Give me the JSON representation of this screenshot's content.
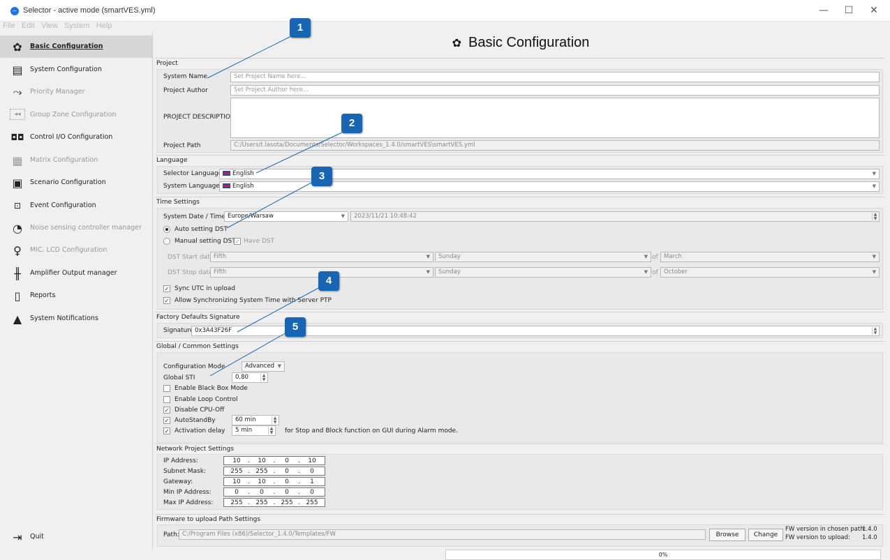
{
  "window": {
    "title": "Selector - active mode (smartVES.yml)",
    "min_icon": "minimize-icon",
    "max_icon": "maximize-icon",
    "close_icon": "close-icon"
  },
  "menu": [
    "File",
    "Edit",
    "View",
    "System",
    "Help"
  ],
  "sidebar": {
    "items": [
      {
        "label": "Basic Configuration",
        "icon": "gear-icon"
      },
      {
        "label": "System Configuration",
        "icon": "server-icon"
      },
      {
        "label": "Priority Manager",
        "icon": "priority-arrow-icon"
      },
      {
        "label": "Group Zone Configuration",
        "icon": "group-zone-icon"
      },
      {
        "label": "Control I/O Configuration",
        "icon": "io-icon"
      },
      {
        "label": "Matrix Configuration",
        "icon": "matrix-icon"
      },
      {
        "label": "Scenario Configuration",
        "icon": "scenario-icon"
      },
      {
        "label": "Event Configuration",
        "icon": "event-icon"
      },
      {
        "label": "Noise sensing controller manager",
        "icon": "noise-sensor-icon"
      },
      {
        "label": "MIC. LCD Configuration",
        "icon": "microphone-icon"
      },
      {
        "label": "Amplifier Output manager",
        "icon": "amplifier-icon"
      },
      {
        "label": "Reports",
        "icon": "document-icon"
      },
      {
        "label": "System Notifications",
        "icon": "warning-icon"
      }
    ],
    "quit": "Quit"
  },
  "main": {
    "title": "Basic Configuration",
    "project": {
      "header": "Project",
      "system_name_label": "System Name",
      "system_name_placeholder": "Set Project Name here...",
      "author_label": "Project Author",
      "author_placeholder": "Set Project Author here...",
      "description_label": "PROJECT DESCRIPTION",
      "path_label": "Project Path",
      "path_value": "C:/Users/t.lasota/Documents/Selector/Workspaces_1.4.0/smartVES\\smartVES.yml"
    },
    "language": {
      "header": "Language",
      "selector_label": "Selector Language:",
      "selector_value": "English",
      "system_label": "System Language:",
      "system_value": "English"
    },
    "time": {
      "header": "Time Settings",
      "datetime_label": "System Date / Time:",
      "timezone": "Europe/Warsaw",
      "datetime_value": "2023/11/21 10:48:42",
      "auto_dst": "Auto setting DST",
      "manual_dst": "Manual setting DST",
      "have_dst": "Have DST",
      "dst_start_label": "DST Start date:",
      "dst_stop_label": "DST Stop date:",
      "start_week": "Fifth",
      "start_day": "Sunday",
      "start_month": "March",
      "stop_week": "Fifth",
      "stop_day": "Sunday",
      "stop_month": "October",
      "of": "of",
      "sync_utc": "Sync UTC in upload",
      "allow_ptp": "Allow Synchronizing System Time with Server PTP"
    },
    "factory": {
      "header": "Factory Defaults Signature",
      "signature_label": "Signature",
      "signature_value": "0x3A43F26F"
    },
    "global": {
      "header": "Global / Common Settings",
      "config_mode_label": "Configuration Mode",
      "config_mode_value": "Advanced",
      "global_sti_label": "Global STI",
      "global_sti_value": "0,80",
      "black_box": "Enable Black Box Mode",
      "loop_control": "Enable Loop Control",
      "disable_cpu_off": "Disable CPU-Off",
      "auto_standby": "AutoStandBy",
      "auto_standby_value": "60 min",
      "activation_delay": "Activation delay",
      "activation_delay_value": "5 min",
      "activation_note": "for Stop and Block function on GUI during Alarm mode."
    },
    "network": {
      "header": "Network Project Settings",
      "rows": [
        {
          "label": "IP Address:",
          "octets": [
            "10",
            "10",
            "0",
            "10"
          ]
        },
        {
          "label": "Subnet Mask:",
          "octets": [
            "255",
            "255",
            "0",
            "0"
          ]
        },
        {
          "label": "Gateway:",
          "octets": [
            "10",
            "10",
            "0",
            "1"
          ]
        },
        {
          "label": "Min IP Address:",
          "octets": [
            "0",
            "0",
            "0",
            "0"
          ]
        },
        {
          "label": "Max IP Address:",
          "octets": [
            "255",
            "255",
            "255",
            "255"
          ]
        }
      ]
    },
    "firmware": {
      "header": "Firmware to upload Path Settings",
      "path_label": "Path:",
      "path_value": "C:/Program Files (x86)/Selector_1.4.0/Templates/FW",
      "browse": "Browse",
      "change": "Change",
      "fw_chosen_label": "FW version in chosen path:",
      "fw_chosen_value": "1.4.0",
      "fw_upload_label": "FW version to upload:",
      "fw_upload_value": "1.4.0"
    }
  },
  "status": {
    "progress_text": "0%",
    "progress": 0
  },
  "callouts": [
    "1",
    "2",
    "3",
    "4",
    "5"
  ],
  "colors": {
    "callout": "#1766b6",
    "active_nav": "#d6d6d6"
  }
}
